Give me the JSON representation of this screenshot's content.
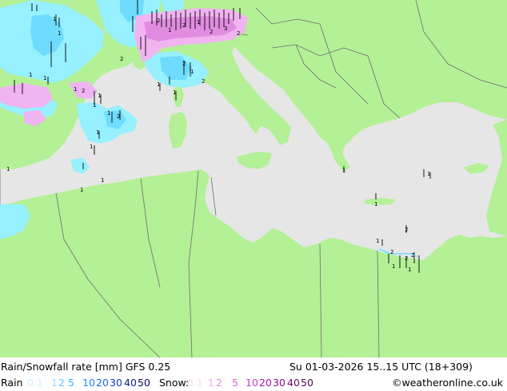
{
  "map": {
    "colors": {
      "sea": "#e6e6e6",
      "land": "#b4f096",
      "border": "#6e6e6e",
      "rain_light": "#96f0ff",
      "rain_medium": "#6edcff",
      "snow_light": "#f0b4f0",
      "snow_medium": "#e18ce1",
      "marker": "#000000"
    }
  },
  "footer": {
    "title": "Rain/Snowfall rate [mm] GFS 0.25",
    "datetime": "Su 01-03-2026 15..15 UTC (18+309)",
    "rain_label": "Rain",
    "snow_label": "Snow:",
    "credit": "©weatheronline.co.uk",
    "rain_scale": [
      {
        "label": "0.1",
        "color": "#d2f0ff"
      },
      {
        "label": "1",
        "color": "#96dcff"
      },
      {
        "label": "2",
        "color": "#64c8ff"
      },
      {
        "label": "5",
        "color": "#32b4ff"
      },
      {
        "label": "10",
        "color": "#1e8cff"
      },
      {
        "label": "20",
        "color": "#1464dc"
      },
      {
        "label": "30",
        "color": "#0a3cb4"
      },
      {
        "label": "40",
        "color": "#0a1e8c"
      },
      {
        "label": "50",
        "color": "#0a0a64"
      }
    ],
    "snow_scale": [
      {
        "label": "0.1",
        "color": "#fadcfa"
      },
      {
        "label": "1",
        "color": "#f0b4f0"
      },
      {
        "label": "2",
        "color": "#e18ce1"
      },
      {
        "label": "5",
        "color": "#d264d2"
      },
      {
        "label": "10",
        "color": "#c83cc8"
      },
      {
        "label": "20",
        "color": "#aa14aa"
      },
      {
        "label": "30",
        "color": "#8c0a8c"
      },
      {
        "label": "40",
        "color": "#6e0a6e"
      },
      {
        "label": "50",
        "color": "#500a50"
      }
    ]
  }
}
